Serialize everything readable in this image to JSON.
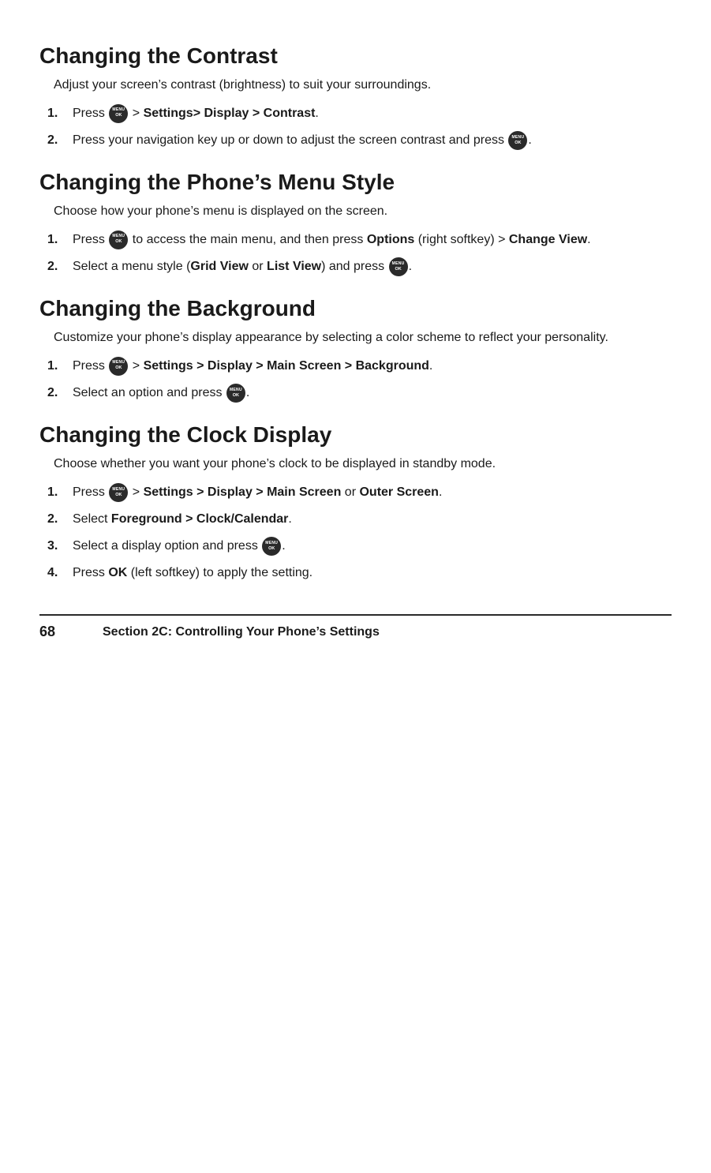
{
  "sections": [
    {
      "id": "contrast",
      "heading": "Changing the Contrast",
      "intro": "Adjust your screen’s contrast (brightness) to suit your surroundings.",
      "steps": [
        {
          "number": "1.",
          "html": "Press [MENU] > <b>Settings> Display > Contrast</b>."
        },
        {
          "number": "2.",
          "html": "Press your navigation key up or down to adjust the screen contrast and press [MENU]."
        }
      ]
    },
    {
      "id": "menu-style",
      "heading": "Changing the Phone’s Menu Style",
      "intro": "Choose how your phone’s menu is displayed on the screen.",
      "steps": [
        {
          "number": "1.",
          "html": "Press [MENU] to access the main menu, and then press <b>Options</b> (right softkey) > <b>Change View</b>."
        },
        {
          "number": "2.",
          "html": "Select a menu style (<b>Grid View</b> or <b>List View</b>) and press [MENU]."
        }
      ]
    },
    {
      "id": "background",
      "heading": "Changing the Background",
      "intro": "Customize your phone’s display appearance by selecting a color scheme to reflect your personality.",
      "steps": [
        {
          "number": "1.",
          "html": "Press [MENU] > <b>Settings > Display > Main Screen > Background</b>."
        },
        {
          "number": "2.",
          "html": "Select an option and press [MENU]."
        }
      ]
    },
    {
      "id": "clock-display",
      "heading": "Changing the Clock Display",
      "intro": "Choose whether you want your phone’s clock to be displayed in standby mode.",
      "steps": [
        {
          "number": "1.",
          "html": "Press [MENU] > <b>Settings > Display > Main Screen</b> or <b>Outer Screen</b>."
        },
        {
          "number": "2.",
          "html": "Select <b>Foreground > Clock/Calendar</b>."
        },
        {
          "number": "3.",
          "html": "Select a display option and press [MENU]."
        },
        {
          "number": "4.",
          "html": "Press <b>OK</b> (left softkey) to apply the setting."
        }
      ]
    }
  ],
  "footer": {
    "page": "68",
    "text": "Section 2C: Controlling Your Phone’s Settings"
  }
}
